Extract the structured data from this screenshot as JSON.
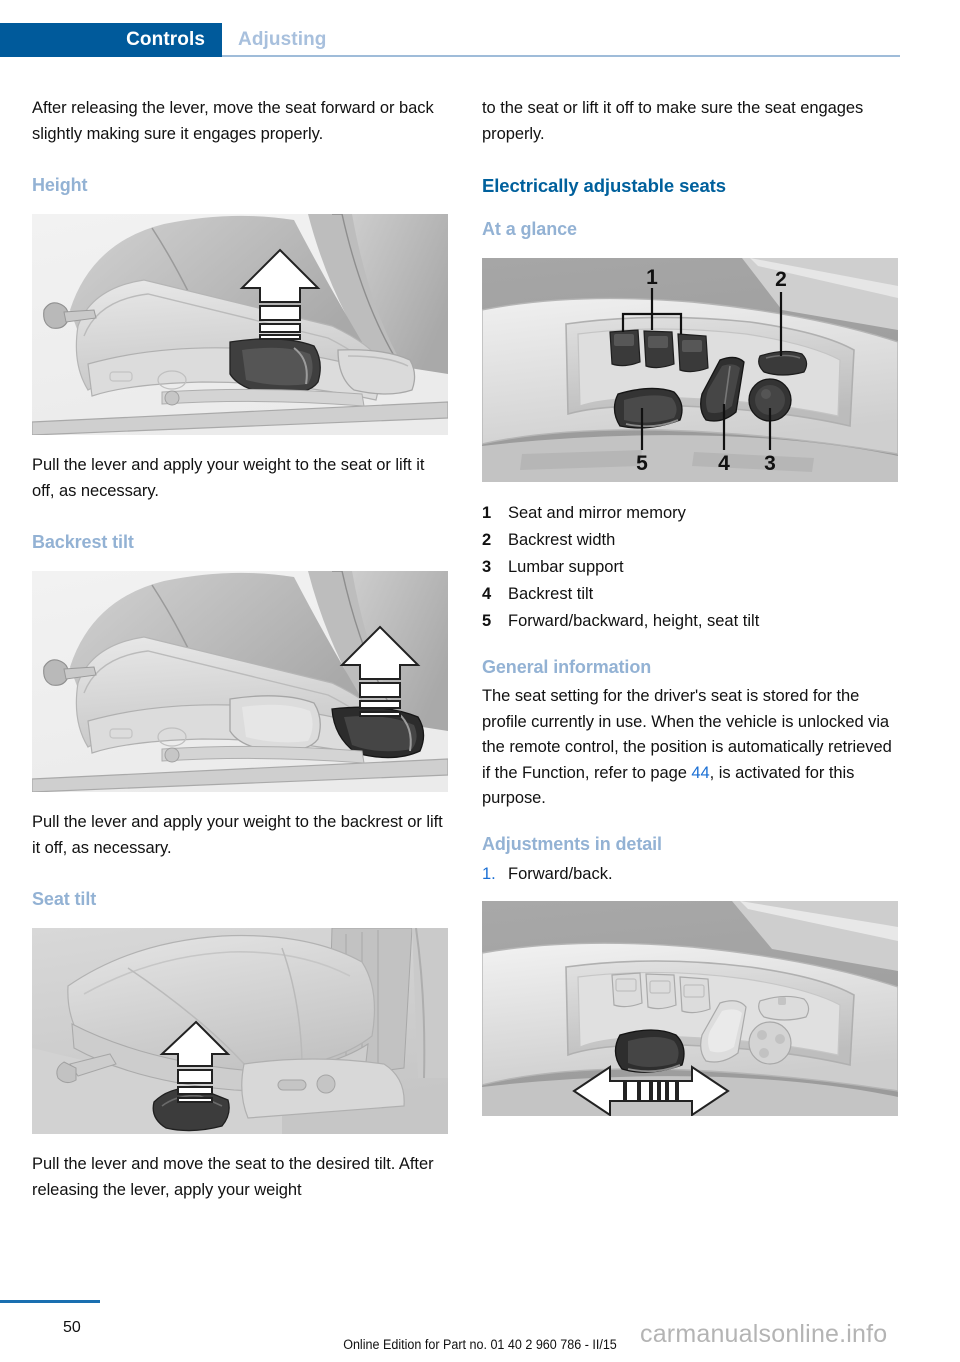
{
  "header": {
    "active_tab": "Controls",
    "inactive_tab": "Adjusting",
    "active_bg": "#005a9b",
    "inactive_color": "#a8c0dd"
  },
  "colors": {
    "heading_main": "#00609c",
    "heading_sub": "#93b2d4",
    "link": "#1a6fd4",
    "rule": "#9fbcd9"
  },
  "left_column": {
    "intro_paragraph": "After releasing the lever, move the seat forward or back slightly making sure it engages properly.",
    "height_heading": "Height",
    "height_figure_alt": "Car seat side view with height adjustment lever and upward arrow",
    "height_caption": "Pull the lever and apply your weight to the seat or lift it off, as necessary.",
    "backrest_heading": "Backrest tilt",
    "backrest_figure_alt": "Car seat side view with backrest tilt lever and upward arrow",
    "backrest_caption": "Pull the lever and apply your weight to the backrest or lift it off, as necessary.",
    "seattilt_heading": "Seat tilt",
    "seattilt_figure_alt": "Car seat cushion with seat tilt lever and upward arrow",
    "seattilt_caption": "Pull the lever and move the seat to the desired tilt. After releasing the lever, apply your weight"
  },
  "right_column": {
    "continued_paragraph": "to the seat or lift it off to make sure the seat engages properly.",
    "section_heading": "Electrically adjustable seats",
    "at_a_glance_heading": "At a glance",
    "controls_figure_alt": "Electric seat control panel with five numbered callouts",
    "legend": [
      {
        "num": "1",
        "label": "Seat and mirror memory"
      },
      {
        "num": "2",
        "label": "Backrest width"
      },
      {
        "num": "3",
        "label": "Lumbar support"
      },
      {
        "num": "4",
        "label": "Backrest tilt"
      },
      {
        "num": "5",
        "label": "Forward/backward, height, seat tilt"
      }
    ],
    "general_info_heading": "General information",
    "general_info_part1": "The seat setting for the driver's seat is stored for the profile currently in use. When the vehicle is unlocked via the remote control, the position is automatically retrieved if the Function, refer to page ",
    "general_info_link": "44",
    "general_info_part2": ", is activated for this purpose.",
    "adjustments_heading": "Adjustments in detail",
    "steps": [
      {
        "num": "1.",
        "label": "Forward/back."
      }
    ],
    "forwardback_figure_alt": "Electric seat control panel with left-right double arrow for forward and back adjustment"
  },
  "footer": {
    "page_number": "50",
    "edition_note": "Online Edition for Part no. 01 40 2 960 786 - II/15",
    "watermark": "carmanualsonline.info"
  }
}
